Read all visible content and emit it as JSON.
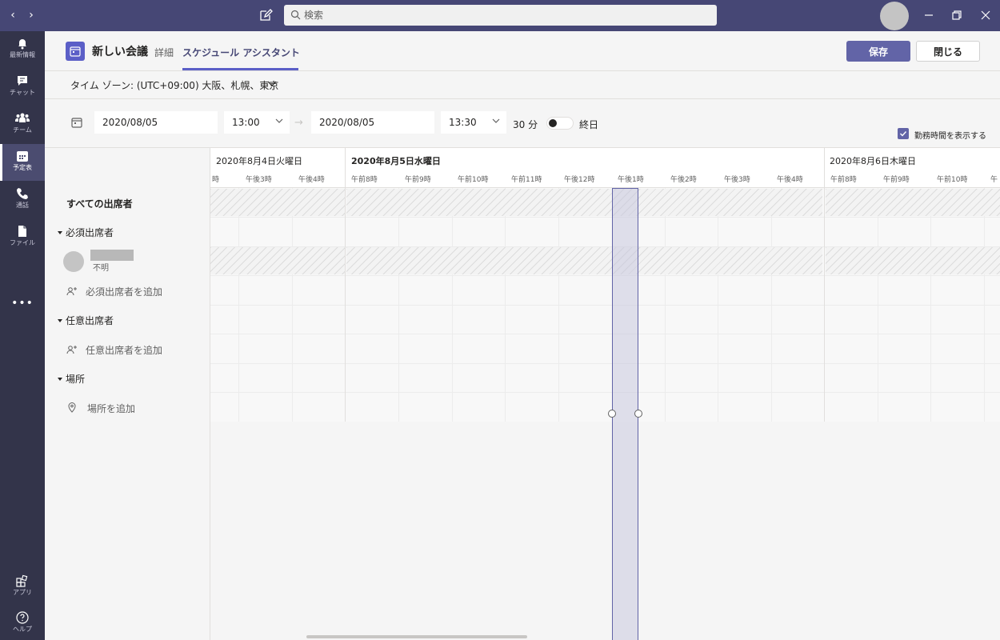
{
  "search": {
    "placeholder": "検索"
  },
  "nav": {
    "back": "‹",
    "forward": "›"
  },
  "rail": [
    {
      "label": "最新情報",
      "icon": "bell-icon"
    },
    {
      "label": "チャット",
      "icon": "chat-icon"
    },
    {
      "label": "チーム",
      "icon": "teams-icon"
    },
    {
      "label": "予定表",
      "icon": "calendar-icon",
      "active": true
    },
    {
      "label": "通話",
      "icon": "phone-icon"
    },
    {
      "label": "ファイル",
      "icon": "file-icon"
    },
    {
      "label": "アプリ",
      "icon": "apps-icon"
    },
    {
      "label": "ヘルプ",
      "icon": "help-icon"
    }
  ],
  "rail_more": "•••",
  "header": {
    "title": "新しい会議",
    "tab_details": "詳細",
    "tab_scheduling": "スケジュール アシスタント",
    "save": "保存",
    "close": "閉じる"
  },
  "timezone": "タイム ゾーン: (UTC+09:00) 大阪、札幌、東京",
  "date_row": {
    "start_date": "2020/08/05",
    "start_time": "13:00",
    "arrow": "→",
    "end_date": "2020/08/05",
    "end_time": "13:30",
    "duration": "30 分",
    "all_day": "終日",
    "show_working_hours": "勤務時間を表示する"
  },
  "attendees": {
    "all": "すべての出席者",
    "required_header": "必須出席者",
    "person_status": "不明",
    "add_required": "必須出席者を追加",
    "optional_header": "任意出席者",
    "add_optional": "任意出席者を追加",
    "location_header": "場所",
    "add_location": "場所を追加"
  },
  "timeline": {
    "days": [
      "2020年8月4日火曜日",
      "2020年8月5日水曜日",
      "2020年8月6日木曜日"
    ],
    "day1_hours": [
      "時",
      "午後3時",
      "午後4時"
    ],
    "day2_hours": [
      "午前8時",
      "午前9時",
      "午前10時",
      "午前11時",
      "午後12時",
      "午後1時",
      "午後2時",
      "午後3時",
      "午後4時"
    ],
    "day3_hours": [
      "午前8時",
      "午前9時",
      "午前10時",
      "午"
    ]
  }
}
